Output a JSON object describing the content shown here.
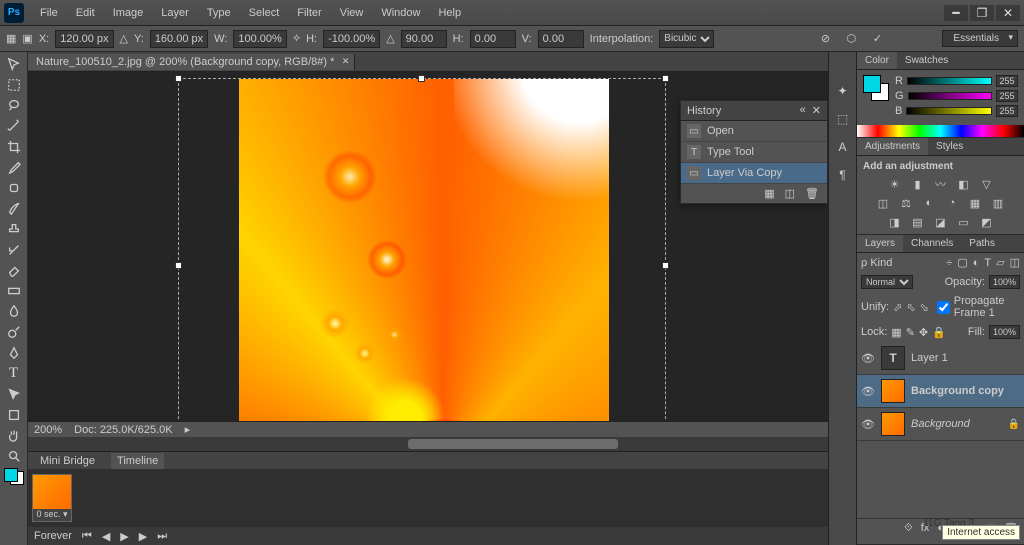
{
  "app": {
    "logo": "Ps"
  },
  "menu": [
    "File",
    "Edit",
    "Image",
    "Layer",
    "Type",
    "Select",
    "Filter",
    "View",
    "Window",
    "Help"
  ],
  "options": {
    "x": "120.00 px",
    "y": "160.00 px",
    "w": "100.00%",
    "h": "-100.00%",
    "angle": "90.00",
    "h2": "0.00",
    "v": "0.00",
    "interp_label": "Interpolation:",
    "interp": "Bicubic",
    "workspace": "Essentials"
  },
  "doc_tab": "Nature_100510_2.jpg @ 200% (Background copy, RGB/8#) *",
  "history": {
    "title": "History",
    "items": [
      {
        "icon": "▭",
        "label": "Open"
      },
      {
        "icon": "T",
        "label": "Type Tool"
      },
      {
        "icon": "▭",
        "label": "Layer Via Copy",
        "active": true
      }
    ]
  },
  "status": {
    "zoom": "200%",
    "doc": "Doc: 225.0K/625.0K"
  },
  "minibridge": {
    "tab1": "Mini Bridge",
    "tab2": "Timeline",
    "thumb_caption": "0 sec. ▾",
    "ctrl": "Forever"
  },
  "color": {
    "tab1": "Color",
    "tab2": "Swatches",
    "r_label": "R",
    "g_label": "G",
    "b_label": "B",
    "r": "255",
    "g": "255",
    "b": "255"
  },
  "adjustments": {
    "tab1": "Adjustments",
    "tab2": "Styles",
    "heading": "Add an adjustment"
  },
  "layers": {
    "tab1": "Layers",
    "tab2": "Channels",
    "tab3": "Paths",
    "kind": "ρ Kind",
    "blend": "Normal",
    "opacity_label": "Opacity:",
    "opacity": "100%",
    "unify": "Unify:",
    "propagate": "Propagate Frame 1",
    "lock": "Lock:",
    "fill_label": "Fill:",
    "fill": "100%",
    "items": [
      {
        "type": "T",
        "name": "Layer 1"
      },
      {
        "type": "img",
        "name": "Background copy",
        "selected": true,
        "bold": true
      },
      {
        "type": "img",
        "name": "Background",
        "locked": true,
        "italic": true
      }
    ]
  },
  "tray": {
    "user": "11G Tang 3",
    "net": "Internet access"
  }
}
